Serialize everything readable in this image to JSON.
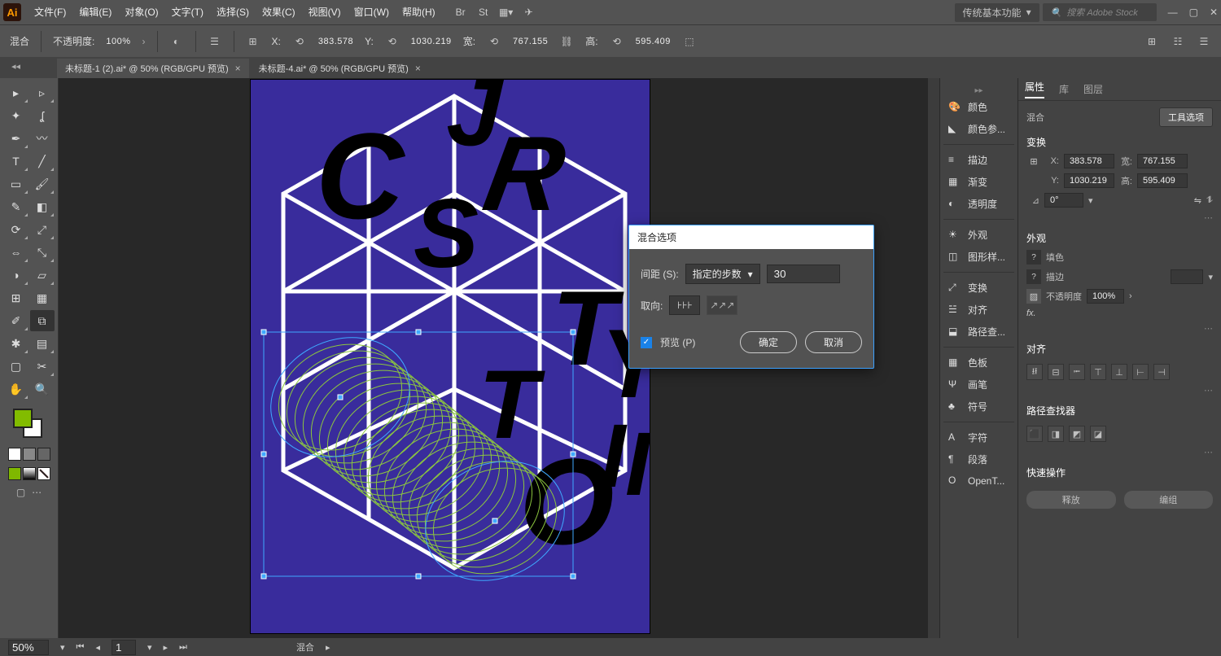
{
  "titlebar": {
    "menus": [
      "文件(F)",
      "编辑(E)",
      "对象(O)",
      "文字(T)",
      "选择(S)",
      "效果(C)",
      "视图(V)",
      "窗口(W)",
      "帮助(H)"
    ],
    "workspace_label": "传统基本功能",
    "search_placeholder": "搜索 Adobe Stock"
  },
  "controlbar": {
    "object_label": "混合",
    "opacity_label": "不透明度:",
    "opacity_value": "100%",
    "x_label": "X:",
    "x_value": "383.578",
    "y_label": "Y:",
    "y_value": "1030.219",
    "w_label": "宽:",
    "w_value": "767.155",
    "h_label": "高:",
    "h_value": "595.409"
  },
  "tabs": [
    {
      "label": "未标题-1 (2).ai* @ 50% (RGB/GPU 预览)",
      "active": false
    },
    {
      "label": "未标题-4.ai* @ 50% (RGB/GPU 预览)",
      "active": true
    }
  ],
  "dock": {
    "items1": [
      "颜色",
      "颜色参..."
    ],
    "items2": [
      "描边",
      "渐变",
      "透明度"
    ],
    "items3": [
      "外观",
      "图形样..."
    ],
    "items4": [
      "变换",
      "对齐",
      "路径查..."
    ],
    "items5": [
      "色板",
      "画笔",
      "符号"
    ],
    "items6": [
      "字符",
      "段落",
      "OpenT..."
    ]
  },
  "props": {
    "tabs": [
      "属性",
      "库",
      "图层"
    ],
    "object_type": "混合",
    "tool_options_btn": "工具选项",
    "sec_transform": "变换",
    "x_label": "X:",
    "x_value": "383.578",
    "y_label": "Y:",
    "y_value": "1030.219",
    "w_label": "宽:",
    "w_value": "767.155",
    "h_label": "高:",
    "h_value": "595.409",
    "angle_label": "⊿",
    "angle_value": "0°",
    "sec_appearance": "外观",
    "fill_label": "填色",
    "stroke_label": "描边",
    "opacity_label": "不透明度",
    "opacity_value": "100%",
    "sec_align": "对齐",
    "sec_pathfinder": "路径查找器",
    "sec_quick": "快速操作",
    "release_btn": "释放",
    "group_btn": "编组"
  },
  "dialog": {
    "title": "混合选项",
    "spacing_label": "间距 (S):",
    "spacing_mode": "指定的步数",
    "spacing_value": "30",
    "orient_label": "取向:",
    "preview_label": "预览 (P)",
    "ok_btn": "确定",
    "cancel_btn": "取消"
  },
  "statusbar": {
    "zoom": "50%",
    "page": "1",
    "tool": "混合"
  }
}
